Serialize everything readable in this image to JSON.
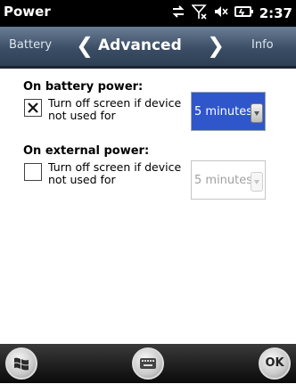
{
  "statusbar": {
    "title": "Power",
    "time": "2:37",
    "icons": [
      "sync-icon",
      "no-signal-icon",
      "volume-mute-icon",
      "battery-charging-icon"
    ]
  },
  "tabs": {
    "prev": "Battery",
    "current": "Advanced",
    "next": "Info"
  },
  "battery": {
    "title": "On battery power:",
    "label_line1": "Turn off screen if device",
    "label_line2": "not used for",
    "checked": true,
    "value": "5 minutes"
  },
  "external": {
    "title": "On external power:",
    "label_line1": "Turn off screen if device",
    "label_line2": "not used for",
    "checked": false,
    "value": "5 minutes"
  },
  "bottombar": {
    "ok_label": "OK"
  },
  "colors": {
    "accent": "#2f56ca",
    "tabbar": "#3b4e66",
    "disabled_text": "#a0a0a0"
  }
}
